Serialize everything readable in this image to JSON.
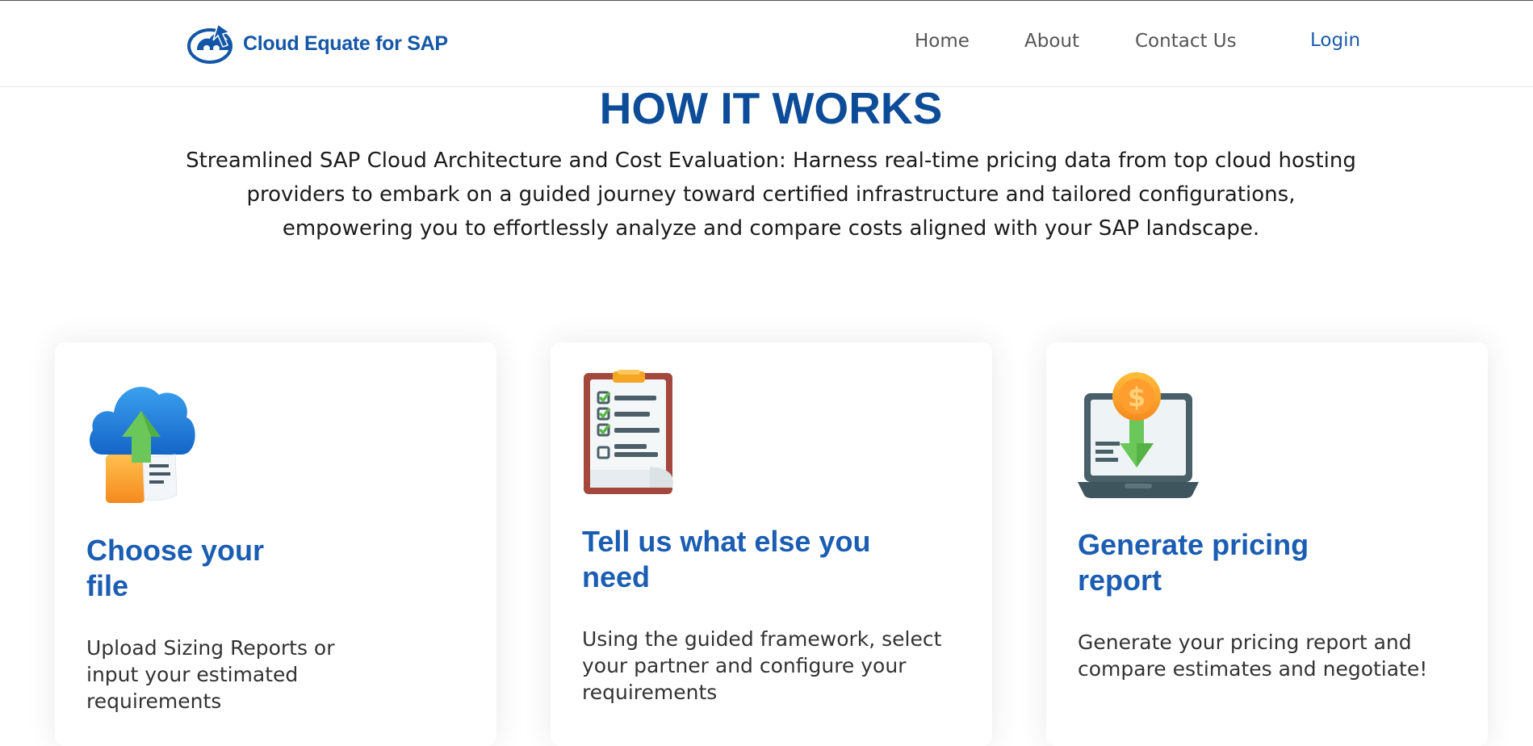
{
  "header": {
    "brand": "Cloud Equate for SAP",
    "nav": {
      "home": "Home",
      "about": "About",
      "contact": "Contact Us",
      "login": "Login"
    }
  },
  "hero": {
    "title": "HOW IT WORKS",
    "description": "Streamlined SAP Cloud Architecture and Cost Evaluation: Harness real-time pricing data from top cloud hosting providers to embark on a guided journey toward certified infrastructure and tailored configurations, empowering you to effortlessly analyze and compare costs aligned with your SAP landscape."
  },
  "steps": [
    {
      "icon": "cloud-upload-file-icon",
      "title": "Choose your file",
      "description": "Upload Sizing Reports or input your estimated requirements"
    },
    {
      "icon": "clipboard-checklist-icon",
      "title": "Tell us what else you need",
      "description": "Using the guided framework, select your partner and configure your requirements"
    },
    {
      "icon": "laptop-pricing-icon",
      "title": "Generate pricing report",
      "description": "Generate your pricing report and compare estimates and negotiate!"
    }
  ],
  "colors": {
    "brand_blue": "#1457a6",
    "title_blue": "#0d4c98",
    "card_title_blue": "#1a5db2"
  }
}
